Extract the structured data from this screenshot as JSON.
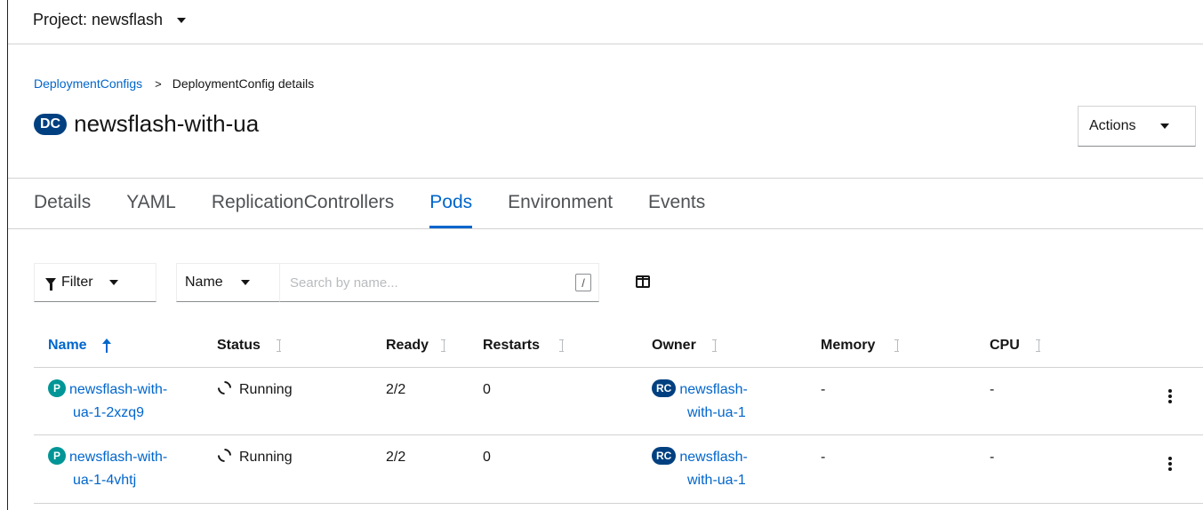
{
  "project": {
    "label": "Project: newsflash"
  },
  "breadcrumb": {
    "parent": "DeploymentConfigs",
    "separator": ">",
    "current": "DeploymentConfig details"
  },
  "header": {
    "badge": "DC",
    "title": "newsflash-with-ua",
    "actions_label": "Actions"
  },
  "tabs": [
    {
      "label": "Details",
      "active": false
    },
    {
      "label": "YAML",
      "active": false
    },
    {
      "label": "ReplicationControllers",
      "active": false
    },
    {
      "label": "Pods",
      "active": true
    },
    {
      "label": "Environment",
      "active": false
    },
    {
      "label": "Events",
      "active": false
    }
  ],
  "toolbar": {
    "filter_label": "Filter",
    "name_select": "Name",
    "search_placeholder": "Search by name...",
    "shortcut_key": "/"
  },
  "table": {
    "columns": [
      {
        "label": "Name",
        "sorted": "ascending"
      },
      {
        "label": "Status"
      },
      {
        "label": "Ready"
      },
      {
        "label": "Restarts"
      },
      {
        "label": "Owner"
      },
      {
        "label": "Memory"
      },
      {
        "label": "CPU"
      }
    ],
    "rows": [
      {
        "pod_badge": "P",
        "name_line1": "newsflash-with-",
        "name_line2": "ua-1-2xzq9",
        "status": "Running",
        "ready": "2/2",
        "restarts": "0",
        "owner_badge": "RC",
        "owner_line1": "newsflash-",
        "owner_line2": "with-ua-1",
        "memory": "-",
        "cpu": "-"
      },
      {
        "pod_badge": "P",
        "name_line1": "newsflash-with-",
        "name_line2": "ua-1-4vhtj",
        "status": "Running",
        "ready": "2/2",
        "restarts": "0",
        "owner_badge": "RC",
        "owner_line1": "newsflash-",
        "owner_line2": "with-ua-1",
        "memory": "-",
        "cpu": "-"
      }
    ]
  },
  "colors": {
    "link": "#0066cc",
    "badge_dark": "#004080",
    "pod_badge": "#009596",
    "border": "#d2d2d2"
  },
  "icons": [
    "caret-down-icon",
    "filter-icon",
    "columns-icon",
    "sort-ascending-icon",
    "sort-icon",
    "sync-icon",
    "kebab-icon"
  ]
}
